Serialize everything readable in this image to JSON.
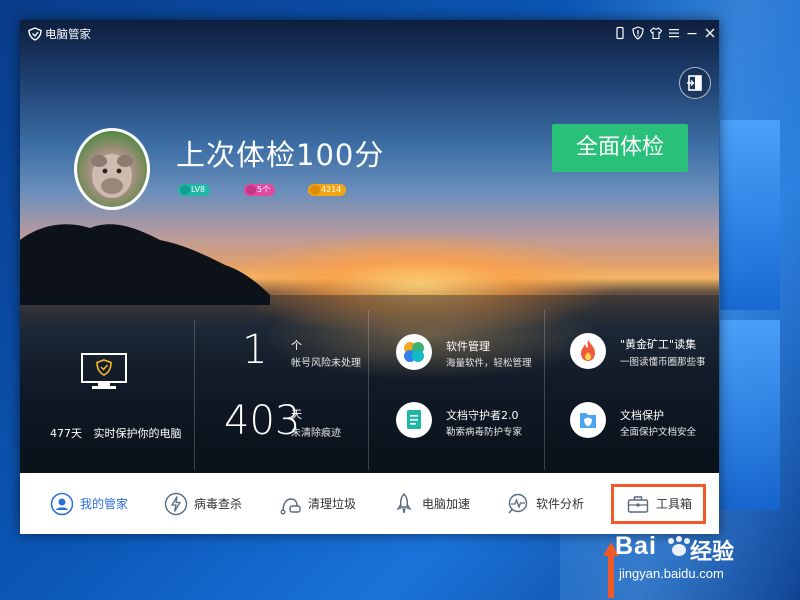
{
  "window": {
    "app_title": "电脑管家",
    "toolbar_icons": [
      "phone-icon",
      "shield-alert-icon",
      "shirt-icon",
      "menu-icon",
      "minimize-icon",
      "close-icon"
    ],
    "exit_icon": "exit-door-icon"
  },
  "header": {
    "score_text": "上次体检100分",
    "badges": [
      {
        "icon": "shield-badge-icon",
        "text": "LV8",
        "color": "#1fb7a6"
      },
      {
        "icon": "list-badge-icon",
        "text": "5个",
        "color": "#e24aa0"
      },
      {
        "icon": "coin-badge-icon",
        "text": "4214",
        "color": "#f3a512"
      }
    ],
    "scan_button": "全面体检",
    "scan_color": "#29c07a"
  },
  "stats": {
    "protect_days": "477天",
    "protect_desc": "实时保护你的电脑",
    "risk_count": "1",
    "risk_unit": "个",
    "risk_desc": "帐号风险未处理",
    "trace_count": "403",
    "trace_unit": "天",
    "trace_desc": "未清除痕迹"
  },
  "features": [
    {
      "icon": "software-manager-icon",
      "title": "软件管理",
      "subtitle": "海量软件，轻松管理"
    },
    {
      "icon": "fire-icon",
      "title": "\"黄金矿工\"读集",
      "subtitle": "一图读懂币圈那些事"
    },
    {
      "icon": "document-guard-icon",
      "title": "文档守护者2.0",
      "subtitle": "勒索病毒防护专家"
    },
    {
      "icon": "document-protect-icon",
      "title": "文档保护",
      "subtitle": "全面保护文档安全"
    }
  ],
  "nav": [
    {
      "icon": "guardian-icon",
      "label": "我的管家",
      "active": true
    },
    {
      "icon": "virus-scan-icon",
      "label": "病毒查杀",
      "active": false
    },
    {
      "icon": "vacuum-icon",
      "label": "清理垃圾",
      "active": false
    },
    {
      "icon": "rocket-icon",
      "label": "电脑加速",
      "active": false
    },
    {
      "icon": "analysis-icon",
      "label": "软件分析",
      "active": false
    },
    {
      "icon": "toolbox-icon",
      "label": "工具箱",
      "active": false
    }
  ],
  "highlight_color": "#f05a28",
  "watermark": {
    "brand": "Bai",
    "brand2": "经验",
    "url": "jingyan.baidu.com"
  }
}
